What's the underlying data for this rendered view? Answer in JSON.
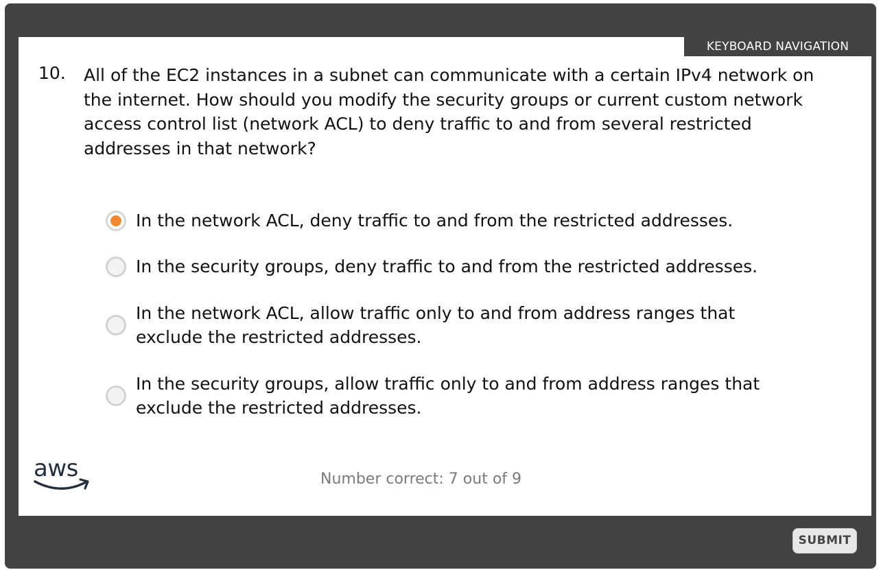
{
  "header": {
    "keyboard_navigation": "KEYBOARD NAVIGATION"
  },
  "question": {
    "number": "10.",
    "text": "All of the EC2 instances in a subnet can communicate with a certain IPv4 network on the internet. How should you modify the security groups or current custom network access control list (network ACL) to deny traffic to and from several restricted addresses in that network?"
  },
  "options": [
    {
      "label": "In the network ACL, deny traffic to and from the restricted addresses.",
      "selected": true
    },
    {
      "label": "In the security groups, deny traffic to and from the restricted addresses.",
      "selected": false
    },
    {
      "label": "In the network ACL, allow traffic only to and from address ranges that exclude the restricted addresses.",
      "selected": false
    },
    {
      "label": "In the security groups, allow traffic only to and from address ranges that exclude the restricted addresses.",
      "selected": false
    }
  ],
  "logo": {
    "text": "aws"
  },
  "footer": {
    "score": "Number correct: 7 out of 9",
    "submit_label": "SUBMIT"
  },
  "colors": {
    "frame": "#424242",
    "panel": "#ffffff",
    "radio_selected": "#f08a30",
    "score_text": "#7a7a7a"
  }
}
